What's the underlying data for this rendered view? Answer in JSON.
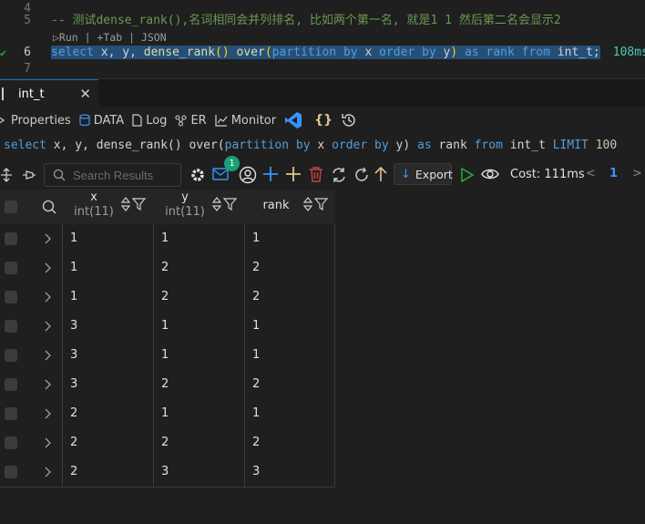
{
  "editor": {
    "lines": [
      {
        "num": "4"
      },
      {
        "num": "5",
        "comment": "-- 测试dense_rank(),名词相同会并列排名, 比如两个第一名, 就是1 1 然后第二名会显示2"
      },
      {
        "num": "6",
        "status": "✔",
        "time": "108ms"
      },
      {
        "num": "7"
      }
    ],
    "codelens": "▷Run | +Tab | JSON",
    "sql_tokens": {
      "select": "select",
      "cols": "x, y,",
      "fn": "dense_rank",
      "paren": "()",
      "over": "over",
      "open": "(",
      "partition": "partition",
      "by1": "by",
      "x": "x",
      "order": "order",
      "by2": "by",
      "y": "y",
      "close": ")",
      "as": "as",
      "rank": "rank",
      "from": "from",
      "table": "int_t;"
    }
  },
  "panel": {
    "tab_label": "int_t",
    "close_glyph": "✕",
    "subtabs": {
      "properties": "Properties",
      "data": "DATA",
      "log": "Log",
      "er": "ER",
      "monitor": "Monitor",
      "braces": "{}"
    },
    "query": {
      "select": "select",
      "cols": "x, y, dense_rank() over(",
      "partition": "partition",
      "by1": "by",
      "x": "x",
      "order": "order",
      "by2": "by",
      "y": "y)",
      "as": "as",
      "rank": "rank",
      "from": "from",
      "table": "int_t",
      "limit": "LIMIT",
      "num": "100"
    }
  },
  "toolbar": {
    "search_placeholder": "Search Results",
    "badge_count": "1",
    "export_label": "Export",
    "export_arrow": "↓",
    "cost": "Cost: 111ms",
    "prev": "<",
    "page": "1",
    "next": ">"
  },
  "grid": {
    "columns": [
      {
        "name": "x",
        "type": "int(11)"
      },
      {
        "name": "y",
        "type": "int(11)"
      },
      {
        "name": "rank",
        "type": ""
      }
    ],
    "rows": [
      [
        "1",
        "1",
        "1"
      ],
      [
        "1",
        "2",
        "2"
      ],
      [
        "1",
        "2",
        "2"
      ],
      [
        "3",
        "1",
        "1"
      ],
      [
        "3",
        "1",
        "1"
      ],
      [
        "3",
        "2",
        "2"
      ],
      [
        "2",
        "1",
        "1"
      ],
      [
        "2",
        "2",
        "2"
      ],
      [
        "2",
        "3",
        "3"
      ]
    ]
  },
  "colors": {
    "accent": "#0078d4",
    "keyword": "#569cd6",
    "function": "#dcdcaa",
    "comment": "#6a9955",
    "success": "#2ea043",
    "badge": "#1a9e73",
    "icon_blue": "#3794ff",
    "icon_yellow": "#e2c08d",
    "icon_red": "#c24444"
  },
  "icons": [
    "pin-icon",
    "unpin-icon",
    "search-icon",
    "gear-icon",
    "mail-icon",
    "user-icon",
    "plus-icon",
    "add-icon",
    "trash-icon",
    "refresh-icon",
    "reload-icon",
    "arrow-up-icon",
    "play-icon",
    "eye-icon",
    "vscode-icon",
    "braces-icon",
    "history-icon"
  ]
}
